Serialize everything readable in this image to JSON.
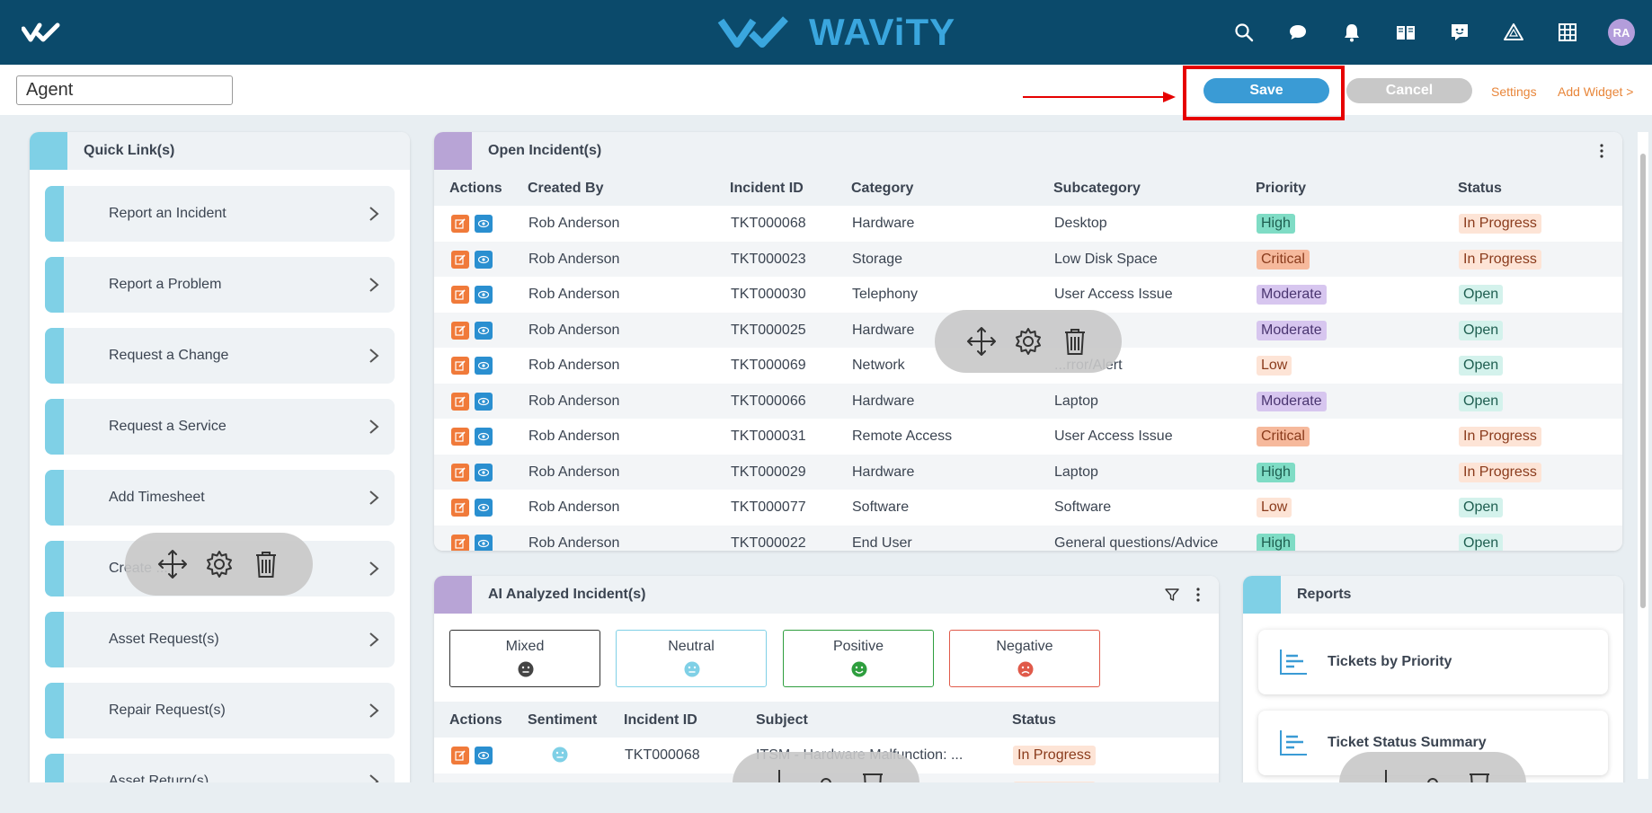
{
  "brand": {
    "name": "WAViTY"
  },
  "nav_icons": [
    "search-icon",
    "chat-icon",
    "bell-icon",
    "book-icon",
    "feedback-icon",
    "alert-triangle-icon",
    "grid-icon"
  ],
  "user": {
    "initials": "RA"
  },
  "toolbar": {
    "dashboard_name": "Agent",
    "save_label": "Save",
    "cancel_label": "Cancel",
    "settings_label": "Settings",
    "add_widget_label": "Add Widget >"
  },
  "quick_links": {
    "title": "Quick Link(s)",
    "items": [
      {
        "label": "Report an Incident"
      },
      {
        "label": "Report a Problem"
      },
      {
        "label": "Request a Change"
      },
      {
        "label": "Request a Service"
      },
      {
        "label": "Add Timesheet"
      },
      {
        "label": "Create ..."
      },
      {
        "label": "Asset Request(s)"
      },
      {
        "label": "Repair Request(s)"
      },
      {
        "label": "Asset Return(s)"
      }
    ]
  },
  "open_incidents": {
    "title": "Open Incident(s)",
    "columns": [
      "Actions",
      "Created By",
      "Incident ID",
      "Category",
      "Subcategory",
      "Priority",
      "Status"
    ],
    "rows": [
      {
        "created_by": "Rob Anderson",
        "id": "TKT000068",
        "category": "Hardware",
        "subcategory": "Desktop",
        "priority": "High",
        "status": "In Progress"
      },
      {
        "created_by": "Rob Anderson",
        "id": "TKT000023",
        "category": "Storage",
        "subcategory": "Low Disk Space",
        "priority": "Critical",
        "status": "In Progress"
      },
      {
        "created_by": "Rob Anderson",
        "id": "TKT000030",
        "category": "Telephony",
        "subcategory": "User Access Issue",
        "priority": "Moderate",
        "status": "Open"
      },
      {
        "created_by": "Rob Anderson",
        "id": "TKT000025",
        "category": "Hardware",
        "subcategory": "",
        "priority": "Moderate",
        "status": "Open"
      },
      {
        "created_by": "Rob Anderson",
        "id": "TKT000069",
        "category": "Network",
        "subcategory": "...rror/Alert",
        "priority": "Low",
        "status": "Open"
      },
      {
        "created_by": "Rob Anderson",
        "id": "TKT000066",
        "category": "Hardware",
        "subcategory": "Laptop",
        "priority": "Moderate",
        "status": "Open"
      },
      {
        "created_by": "Rob Anderson",
        "id": "TKT000031",
        "category": "Remote Access",
        "subcategory": "User Access Issue",
        "priority": "Critical",
        "status": "In Progress"
      },
      {
        "created_by": "Rob Anderson",
        "id": "TKT000029",
        "category": "Hardware",
        "subcategory": "Laptop",
        "priority": "High",
        "status": "In Progress"
      },
      {
        "created_by": "Rob Anderson",
        "id": "TKT000077",
        "category": "Software",
        "subcategory": "Software",
        "priority": "Low",
        "status": "Open"
      },
      {
        "created_by": "Rob Anderson",
        "id": "TKT000022",
        "category": "End User",
        "subcategory": "General questions/Advice",
        "priority": "High",
        "status": "Open"
      }
    ]
  },
  "ai_incidents": {
    "title": "AI Analyzed Incident(s)",
    "sentiments": [
      {
        "label": "Mixed",
        "color": "#333333"
      },
      {
        "label": "Neutral",
        "color": "#7fd0e6"
      },
      {
        "label": "Positive",
        "color": "#2e9e3e"
      },
      {
        "label": "Negative",
        "color": "#e05a4a"
      }
    ],
    "columns": [
      "Actions",
      "Sentiment",
      "Incident ID",
      "Subject",
      "Status"
    ],
    "rows": [
      {
        "id": "TKT000068",
        "subject": "ITSM - Hardware Malfunction: ...",
        "status": "In Progress"
      }
    ]
  },
  "reports": {
    "title": "Reports",
    "items": [
      {
        "label": "Tickets by Priority"
      },
      {
        "label": "Ticket Status Summary"
      }
    ]
  },
  "colors": {
    "topbar": "#0b4a6b",
    "accent_blue": "#3a9bd5",
    "accent_orange": "#e8863a",
    "priority": {
      "High": {
        "bg": "#7fdcc5",
        "fg": "#1e5e50"
      },
      "Critical": {
        "bg": "#f6b99c",
        "fg": "#8a3b1c"
      },
      "Moderate": {
        "bg": "#d7c6ef",
        "fg": "#4a3570"
      },
      "Low": {
        "bg": "#fde4d6",
        "fg": "#8a3b1c"
      }
    },
    "status": {
      "In Progress": {
        "bg": "#fde4d6",
        "fg": "#8a3b1c"
      },
      "Open": {
        "bg": "#d4f2ec",
        "fg": "#1e5e50"
      }
    }
  }
}
